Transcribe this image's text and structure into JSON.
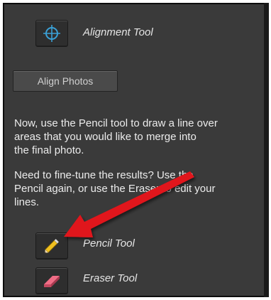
{
  "tools": {
    "alignment": {
      "label": "Alignment Tool",
      "icon": "crosshair-icon"
    },
    "pencil": {
      "label": "Pencil Tool",
      "icon": "pencil-icon"
    },
    "eraser": {
      "label": "Eraser Tool",
      "icon": "eraser-icon"
    }
  },
  "align_button": {
    "label": "Align Photos"
  },
  "instructions": {
    "p1": [
      "Now, use the Pencil tool to draw a line over",
      "areas that you would like to merge into",
      "the final photo."
    ],
    "p2": [
      "Need to fine-tune the results? Use the",
      "Pencil again, or use the Eraser to edit your",
      "lines."
    ]
  },
  "colors": {
    "panel": "#3a3a3a",
    "text": "#ececec",
    "arrow": "#e0141a",
    "accent": "#3aa0d6"
  }
}
